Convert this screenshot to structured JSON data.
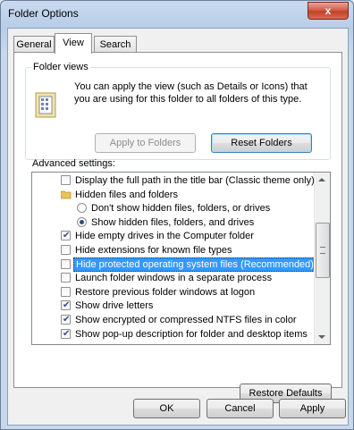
{
  "window": {
    "title": "Folder Options",
    "close_label": "x"
  },
  "tabs": [
    {
      "label": "General"
    },
    {
      "label": "View"
    },
    {
      "label": "Search"
    }
  ],
  "folder_views": {
    "legend": "Folder views",
    "description": "You can apply the view (such as Details or Icons) that you are using for this folder to all folders of this type.",
    "apply_button": "Apply to Folders",
    "reset_button": "Reset Folders"
  },
  "advanced": {
    "label": "Advanced settings:",
    "items": [
      {
        "type": "checkbox",
        "checked": false,
        "label": "Display the full path in the title bar (Classic theme only)"
      },
      {
        "type": "folder",
        "label": "Hidden files and folders"
      },
      {
        "type": "radio",
        "checked": false,
        "label": "Don't show hidden files, folders, or drives"
      },
      {
        "type": "radio",
        "checked": true,
        "label": "Show hidden files, folders, and drives"
      },
      {
        "type": "checkbox",
        "checked": true,
        "label": "Hide empty drives in the Computer folder"
      },
      {
        "type": "checkbox",
        "checked": false,
        "label": "Hide extensions for known file types"
      },
      {
        "type": "checkbox",
        "checked": false,
        "selected": true,
        "label": "Hide protected operating system files (Recommended)"
      },
      {
        "type": "checkbox",
        "checked": false,
        "label": "Launch folder windows in a separate process"
      },
      {
        "type": "checkbox",
        "checked": false,
        "label": "Restore previous folder windows at logon"
      },
      {
        "type": "checkbox",
        "checked": true,
        "label": "Show drive letters"
      },
      {
        "type": "checkbox",
        "checked": true,
        "label": "Show encrypted or compressed NTFS files in color"
      },
      {
        "type": "checkbox",
        "checked": true,
        "label": "Show pop-up description for folder and desktop items"
      }
    ],
    "restore_button": "Restore Defaults"
  },
  "footer": {
    "ok": "OK",
    "cancel": "Cancel",
    "apply": "Apply"
  },
  "colors": {
    "selection": "#3399ff",
    "close_button": "#c2412b"
  }
}
